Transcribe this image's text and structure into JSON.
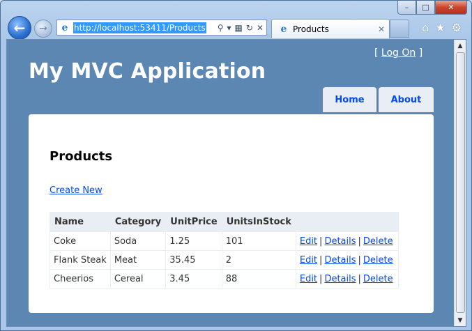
{
  "browser": {
    "address": "http://localhost:53411/Products",
    "tab_title": "Products",
    "window_controls": {
      "minimize": "–",
      "maximize": "□",
      "close": "✕"
    }
  },
  "site": {
    "title": "My MVC Application",
    "logon": {
      "open_bracket": "[",
      "link": "Log On",
      "close_bracket": "]"
    },
    "menu": [
      {
        "label": "Home"
      },
      {
        "label": "About"
      }
    ]
  },
  "page": {
    "heading": "Products",
    "create_link": "Create New",
    "table": {
      "headers": [
        "Name",
        "Category",
        "UnitPrice",
        "UnitsInStock",
        ""
      ],
      "rows": [
        {
          "name": "Coke",
          "category": "Soda",
          "unit_price": "1.25",
          "units_in_stock": "101"
        },
        {
          "name": "Flank Steak",
          "category": "Meat",
          "unit_price": "35.45",
          "units_in_stock": "2"
        },
        {
          "name": "Cheerios",
          "category": "Cereal",
          "unit_price": "3.45",
          "units_in_stock": "88"
        }
      ],
      "actions": {
        "edit": "Edit",
        "details": "Details",
        "delete": "Delete",
        "separator": "|"
      }
    }
  },
  "colors": {
    "page_background": "#5c87b2",
    "link": "#034af3",
    "header_cell": "#e8eef4"
  }
}
